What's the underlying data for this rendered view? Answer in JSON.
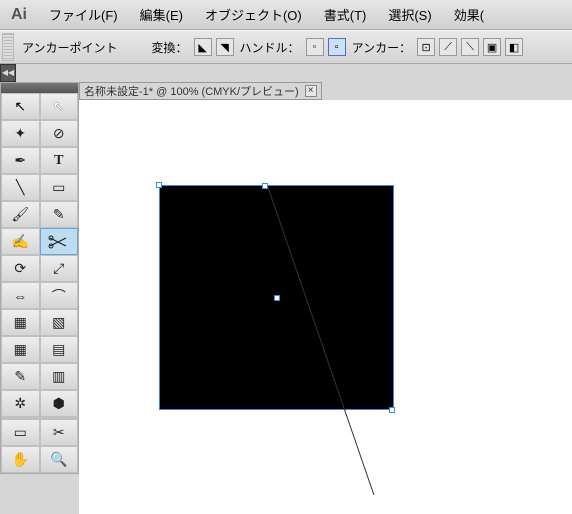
{
  "app": {
    "logo": "Ai"
  },
  "menu": {
    "file": "ファイル(F)",
    "edit": "編集(E)",
    "object": "オブジェクト(O)",
    "type": "書式(T)",
    "select": "選択(S)",
    "effect": "効果("
  },
  "optbar": {
    "anchorpoint": "アンカーポイント",
    "convert": "変換：",
    "handle": "ハンドル：",
    "anchor": "アンカー："
  },
  "tab": {
    "title": "名称未設定-1* @ 100% (CMYK/プレビュー)",
    "close": "×"
  },
  "tools": {
    "selection": "↖",
    "direct": "↖",
    "wand": "✦",
    "lasso": "⊘",
    "pen": "✒",
    "type": "T",
    "line": "╲",
    "rect": "▭",
    "brush": "🖌",
    "pencil": "✎",
    "blob": "✍",
    "eraser": "≈",
    "rotate": "⟳",
    "scale": "⤢",
    "width": "⇔",
    "warp": "⌒",
    "shapebuild": "▦",
    "liveP": "▧",
    "mesh": "▦",
    "gradient": "▤",
    "eyedrop": "✎",
    "blend": "▥",
    "symbol": "✲",
    "graph": "⬢",
    "artboard": "▭",
    "slice": "✂",
    "hand": "✋",
    "zoom": "🔍"
  },
  "collapse": "◀◀"
}
